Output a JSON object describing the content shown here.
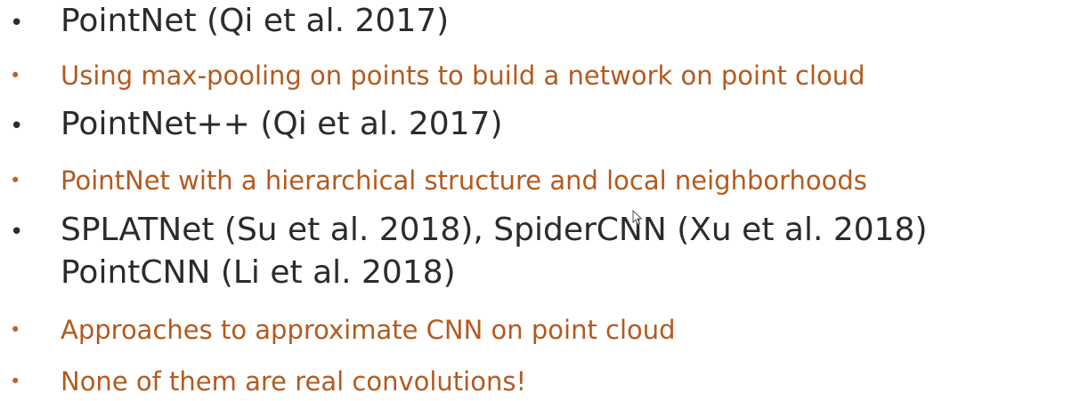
{
  "bullets": [
    {
      "level": "primary",
      "bullet": "•",
      "text": "PointNet (Qi et al. 2017)"
    },
    {
      "level": "secondary",
      "bullet": "•",
      "text": "Using max-pooling on points to build a network on point cloud"
    },
    {
      "level": "primary",
      "bullet": "•",
      "text": "PointNet++ (Qi et al. 2017)"
    },
    {
      "level": "secondary",
      "bullet": "•",
      "text": "PointNet with a hierarchical structure and local neighborhoods"
    },
    {
      "level": "primary",
      "bullet": "•",
      "text": "SPLATNet (Su et al. 2018), SpiderCNN (Xu et al. 2018)"
    },
    {
      "level": "primary-cont",
      "text": "PointCNN (Li et al. 2018)"
    },
    {
      "level": "secondary",
      "bullet": "•",
      "text": "Approaches to approximate CNN on point cloud"
    },
    {
      "level": "secondary",
      "bullet": "•",
      "text": "None of them are real convolutions!"
    }
  ],
  "colors": {
    "primary_text": "#2b2b2b",
    "secondary_text": "#b35a1f"
  },
  "icons": {
    "cursor": "mouse-pointer-icon"
  }
}
